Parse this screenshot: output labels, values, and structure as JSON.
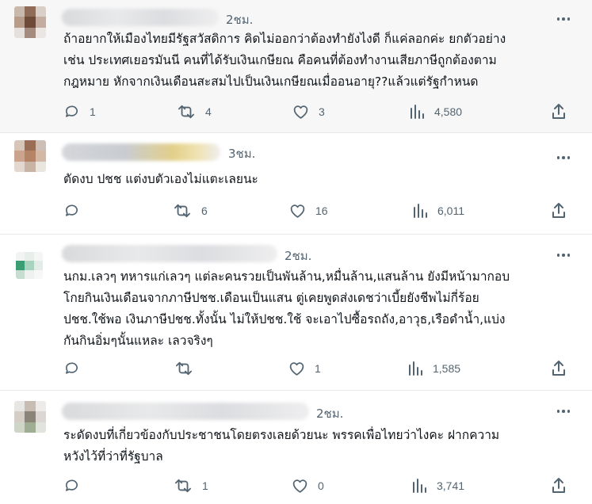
{
  "colors": {
    "icon": "#536471",
    "text": "#0f1419",
    "divider": "#e6e9ec",
    "highlight_bg": "#f7f7f7"
  },
  "posts": [
    {
      "time": "2ชม.",
      "text": "ถ้าอยากให้เมืองไทยมีรัฐสวัสดิการ คิดไม่ออกว่าต้องทำยังไงดี ก็แค่ลอกค่ะ ยกตัวอย่าง\nเช่น ประเทศเยอรมันนี คนที่ได้รับเงินเกษียณ คือคนที่ต้องทำงานเสียภาษีถูกต้องตาม\nกฎหมาย หักจากเงินเดือนสะสมไปเป็นเงินเกษียณเมื่ออนอายุ??แล้วแต่รัฐกำหนด",
      "replies": "1",
      "retweets": "4",
      "likes": "3",
      "views": "4,580"
    },
    {
      "time": "3ชม.",
      "text": "ตัดงบ ปชช แต่งบตัวเองไม่แตะเลยนะ",
      "replies": "",
      "retweets": "6",
      "likes": "16",
      "views": "6,011"
    },
    {
      "time": "2ชม.",
      "text": "นกม.เลวๆ ทหารแก่เลวๆ แต่ละคนรวยเป็นพันล้าน,หมื่นล้าน,แสนล้าน ยังมีหน้ามากอบ\nโกยกินเงินเดือนจากภาษีปชช.เดือนเป็นแสน ตู่เคยพูดส่งเดชว่าเบี้ยยังชีพไม่กี่ร้อย\nปชช.ใช้พอ เงินภาษีปชช.ทั้งนั้น ไม่ให้ปชช.ใช้ จะเอาไปซื้อรถถัง,อาวุธ,เรือดำน้ำ,แบ่ง\nกันกินอิ่มๆนั้นแหละ เลวจริงๆ",
      "replies": "",
      "retweets": "",
      "likes": "1",
      "views": "1,585"
    },
    {
      "time": "2ชม.",
      "text": "ระดัดงบที่เกี่ยวข้องกับประชาชนโดยตรงเลยด้วยนะ พรรคเพื่อไทยว่าไงคะ ฝากความ\nหวังไว้ที่ว่าที่รัฐบาล",
      "replies": "",
      "retweets": "1",
      "likes": "0",
      "views": "3,741"
    }
  ]
}
